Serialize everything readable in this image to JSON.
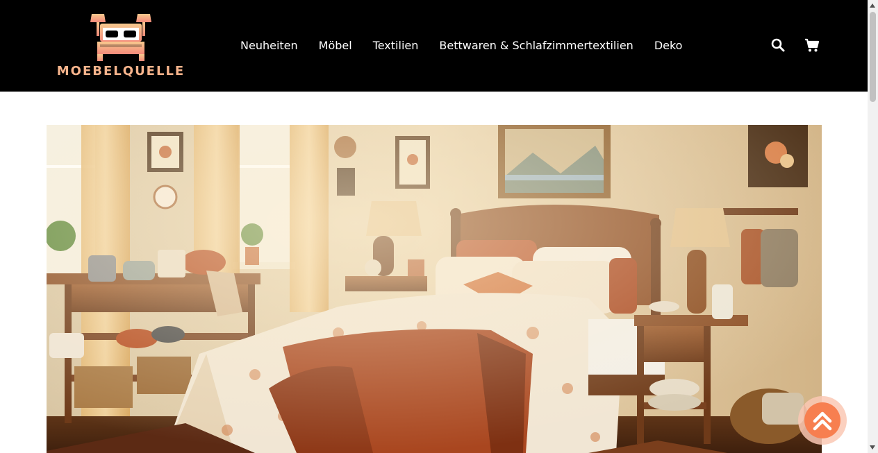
{
  "brand": {
    "name": "MOEBELQUELLE",
    "logo_icon": "bed-with-lamps-icon",
    "accent_color": "#f7b48c"
  },
  "nav": {
    "items": [
      {
        "label": "Neuheiten"
      },
      {
        "label": "Möbel"
      },
      {
        "label": "Textilien"
      },
      {
        "label": "Bettwaren & Schlafzimmertextilien"
      },
      {
        "label": "Deko"
      }
    ]
  },
  "header_actions": {
    "search_icon": "search-icon",
    "cart_icon": "cart-icon"
  },
  "hero": {
    "image_subject": "cozy-rustic-bedroom-photo"
  },
  "back_to_top": {
    "icon": "double-chevron-up-icon",
    "color": "#f77f50"
  },
  "colors": {
    "header_bg": "#000000",
    "nav_text": "#ffffff",
    "page_bg": "#ffffff"
  }
}
